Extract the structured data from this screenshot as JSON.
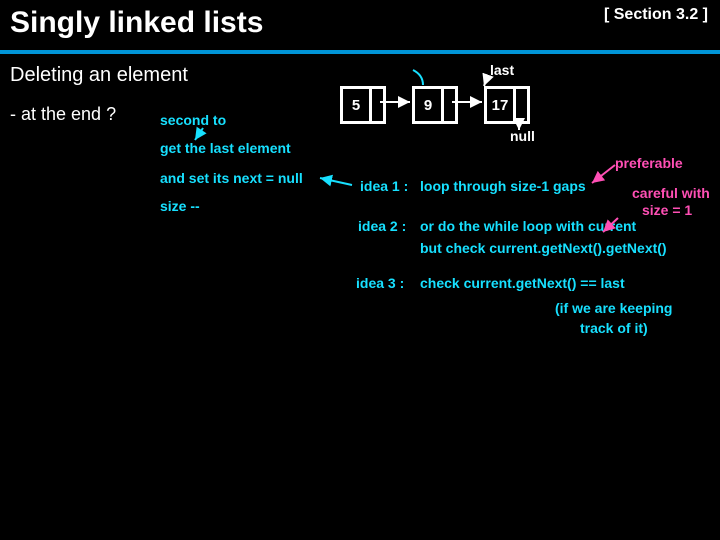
{
  "title": "Singly linked lists",
  "section_ref": "[ Section 3.2 ]",
  "heading": "Deleting an element",
  "subheading": "- at the end ?",
  "diagram": {
    "node1": "5",
    "node2": "9",
    "node3": "17",
    "label_last": "last",
    "label_null": "null"
  },
  "cyan": {
    "secondto": "second to",
    "getlast": "get the last element",
    "setnext": "and set its next = null",
    "sizemm": "size --",
    "idea1": "idea 1 :",
    "idea1_text": "loop through size-1 gaps",
    "idea2": "idea 2 :",
    "idea2_a": "or do the while loop with current",
    "idea2_b": "but check  current.getNext().getNext()",
    "idea3": "idea 3 :",
    "idea3_text": "check  current.getNext() == last",
    "tail_a": "(if we are keeping",
    "tail_b": "track of it)"
  },
  "pink": {
    "preferable": "preferable",
    "careful_a": "careful with",
    "careful_b": "size = 1"
  }
}
